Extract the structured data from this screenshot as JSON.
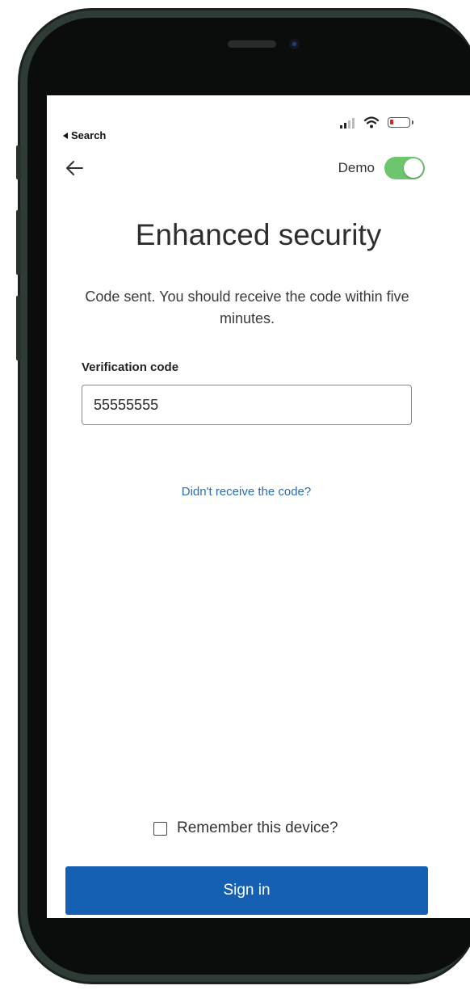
{
  "status_bar": {
    "back_app_label": "Search"
  },
  "header": {
    "demo_label": "Demo",
    "demo_toggle_on": true
  },
  "main": {
    "title": "Enhanced security",
    "info_text": "Code sent. You should receive the code within five minutes.",
    "verification_label": "Verification code",
    "verification_value": "55555555",
    "resend_link": "Didn't receive the code?",
    "remember_label": "Remember this device?",
    "remember_checked": false,
    "sign_in_label": "Sign in"
  },
  "icons": {
    "back": "arrow-left-icon",
    "signal": "cellular-signal-icon",
    "wifi": "wifi-icon",
    "battery": "battery-low-icon"
  },
  "colors": {
    "accent": "#1660b4",
    "link": "#2a6cb5",
    "toggle_on": "#6dc66d",
    "battery_low": "#e02020"
  }
}
